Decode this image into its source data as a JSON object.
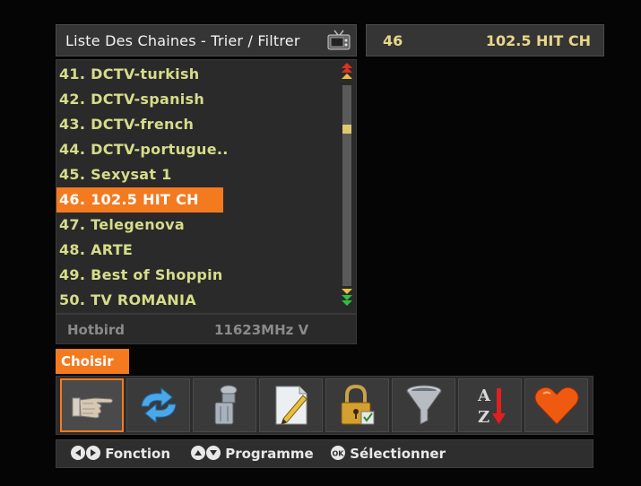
{
  "header": {
    "title": "Liste Des Chaines - Trier / Filtrer",
    "tv_icon": "tv-icon"
  },
  "info": {
    "channel_number": "46",
    "channel_name": "102.5 HIT CH"
  },
  "channels": [
    {
      "label": "41. DCTV-turkish",
      "selected": false
    },
    {
      "label": "42. DCTV-spanish",
      "selected": false
    },
    {
      "label": "43. DCTV-french",
      "selected": false
    },
    {
      "label": "44. DCTV-portugue..",
      "selected": false
    },
    {
      "label": "45. Sexysat 1",
      "selected": false
    },
    {
      "label": "46. 102.5 HIT CH",
      "selected": true
    },
    {
      "label": "47. Telegenova",
      "selected": false
    },
    {
      "label": "48. ARTE",
      "selected": false
    },
    {
      "label": "49. Best of Shoppin",
      "selected": false
    },
    {
      "label": "50. TV ROMANIA",
      "selected": false
    }
  ],
  "satellite": {
    "name": "Hotbird",
    "frequency": "11623MHz V"
  },
  "action_label": "Choisir",
  "functions": [
    {
      "icon": "pointing-hand-icon",
      "active": true
    },
    {
      "icon": "swap-arrows-icon",
      "active": false
    },
    {
      "icon": "trash-can-icon",
      "active": false
    },
    {
      "icon": "edit-pencil-icon",
      "active": false
    },
    {
      "icon": "padlock-icon",
      "active": false
    },
    {
      "icon": "filter-funnel-icon",
      "active": false
    },
    {
      "icon": "sort-az-icon",
      "active": false
    },
    {
      "icon": "heart-icon",
      "active": false
    }
  ],
  "sort_icon_letters": {
    "top": "A",
    "bottom": "Z"
  },
  "help": {
    "fonction": "Fonction",
    "programme": "Programme",
    "selectionner": "Sélectionner",
    "ok_label": "OK"
  },
  "colors": {
    "accent": "#f47a20",
    "channel_text": "#d6dc8a",
    "info_text": "#e8d78a"
  }
}
